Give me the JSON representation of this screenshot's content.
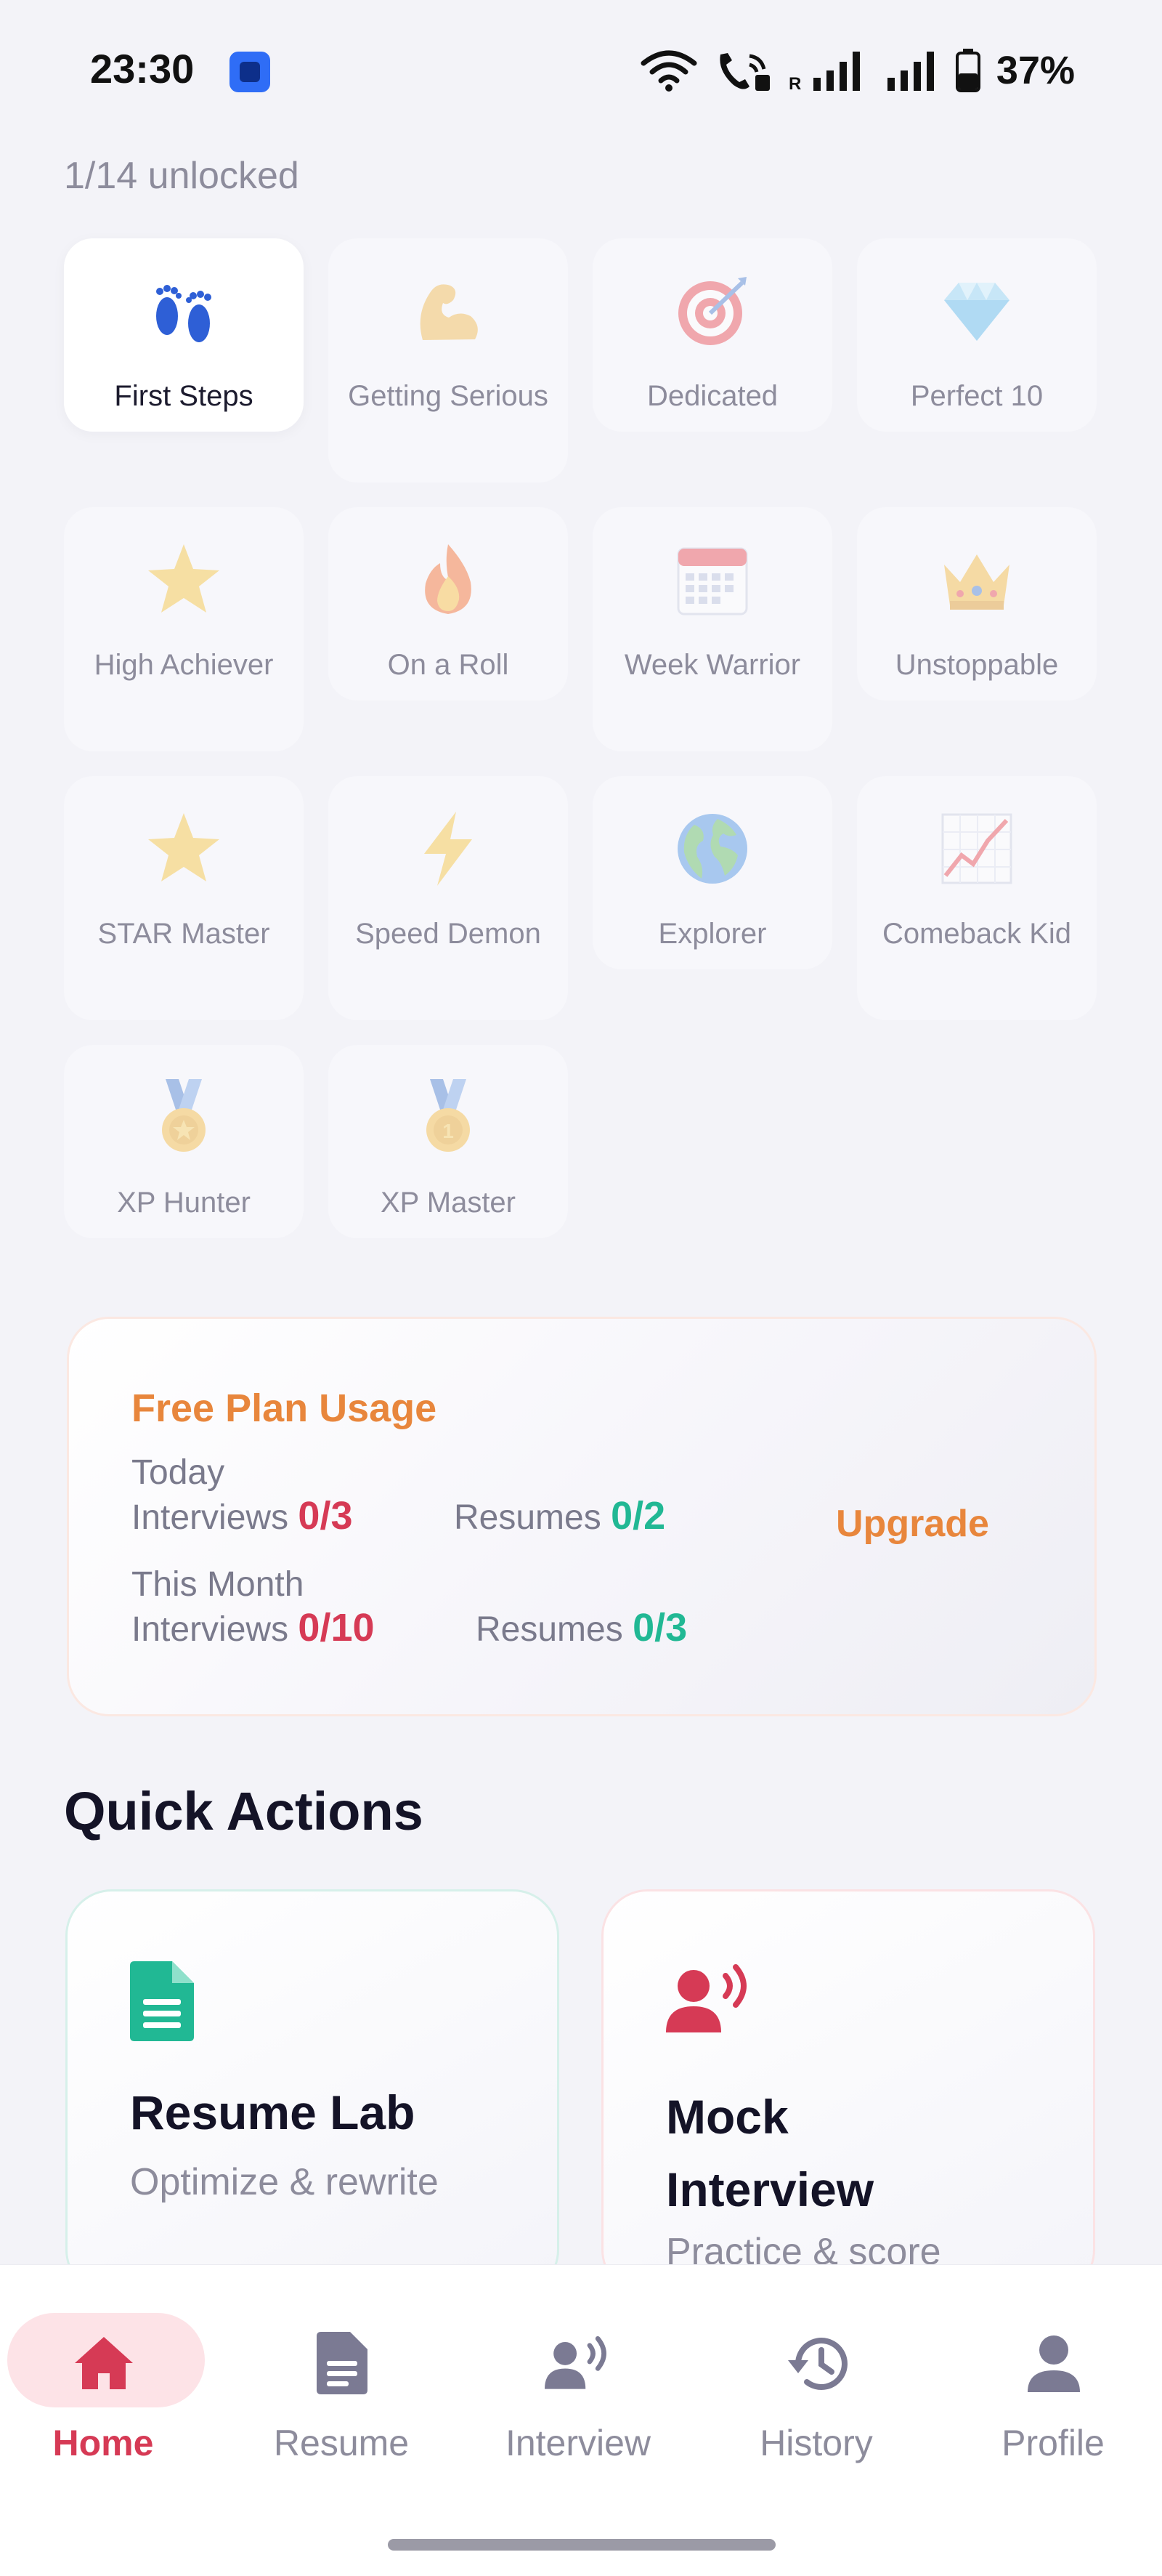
{
  "status_bar": {
    "time": "23:30",
    "battery": "37%",
    "icons": [
      "app-notification-icon",
      "wifi-icon",
      "wifi-call-icon",
      "signal-icon",
      "signal-icon",
      "battery-icon"
    ]
  },
  "achievements": {
    "unlocked_count": "1/14 unlocked",
    "items": [
      {
        "label": "First Steps",
        "icon": "footprints-icon",
        "unlocked": true
      },
      {
        "label": "Getting Serious",
        "icon": "flexed-bicep-icon",
        "unlocked": false
      },
      {
        "label": "Dedicated",
        "icon": "target-icon",
        "unlocked": false
      },
      {
        "label": "Perfect 10",
        "icon": "diamond-icon",
        "unlocked": false
      },
      {
        "label": "High Achiever",
        "icon": "star-icon",
        "unlocked": false
      },
      {
        "label": "On a Roll",
        "icon": "fire-icon",
        "unlocked": false
      },
      {
        "label": "Week Warrior",
        "icon": "calendar-icon",
        "unlocked": false
      },
      {
        "label": "Unstoppable",
        "icon": "crown-icon",
        "unlocked": false
      },
      {
        "label": "STAR Master",
        "icon": "star-icon",
        "unlocked": false
      },
      {
        "label": "Speed Demon",
        "icon": "lightning-icon",
        "unlocked": false
      },
      {
        "label": "Explorer",
        "icon": "globe-icon",
        "unlocked": false
      },
      {
        "label": "Comeback Kid",
        "icon": "trending-chart-icon",
        "unlocked": false
      },
      {
        "label": "XP Hunter",
        "icon": "medal-icon",
        "unlocked": false
      },
      {
        "label": "XP Master",
        "icon": "medal-icon",
        "unlocked": false
      }
    ]
  },
  "usage": {
    "title": "Free Plan Usage",
    "today_label": "Today",
    "month_label": "This Month",
    "interviews_label": "Interviews",
    "resumes_label": "Resumes",
    "today_interviews": "0/3",
    "today_resumes": "0/2",
    "month_interviews": "0/10",
    "month_resumes": "0/3",
    "upgrade_label": "Upgrade",
    "colors": {
      "title": "#e8863c",
      "interviews": "#d63a55",
      "resumes": "#21b894"
    }
  },
  "quick_actions": {
    "title": "Quick Actions",
    "resume_lab": {
      "title": "Resume Lab",
      "subtitle": "Optimize & rewrite",
      "icon": "document-icon",
      "color": "#21b894"
    },
    "mock_interview": {
      "title_line1": "Mock",
      "title_line2": "Interview",
      "subtitle": "Practice & score",
      "icon": "speaking-person-icon",
      "color": "#d63a55"
    }
  },
  "bottom_nav": {
    "items": [
      {
        "label": "Home",
        "icon": "home-icon",
        "active": true
      },
      {
        "label": "Resume",
        "icon": "document-icon",
        "active": false
      },
      {
        "label": "Interview",
        "icon": "speaking-person-icon",
        "active": false
      },
      {
        "label": "History",
        "icon": "history-icon",
        "active": false
      },
      {
        "label": "Profile",
        "icon": "person-icon",
        "active": false
      }
    ],
    "active_color": "#d63a55"
  }
}
